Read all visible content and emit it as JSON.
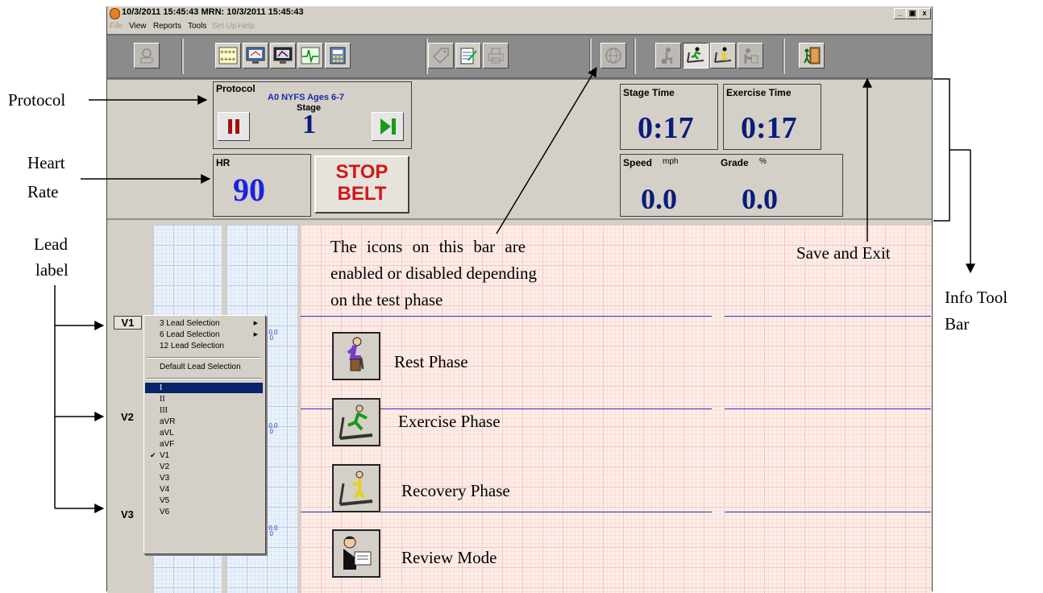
{
  "window": {
    "title": "10/3/2011 15:45:43   MRN: 10/3/2011 15:45:43",
    "controls": {
      "minimize": "_",
      "maximize": " ",
      "close": "x"
    }
  },
  "menu": [
    "File",
    "View",
    "Reports",
    "Tools",
    "Set Up",
    "Help"
  ],
  "menu_disabled": [
    "File",
    "Set Up",
    "Help"
  ],
  "protocol": {
    "label": "Protocol",
    "name": "A0 NYFS Ages 6-7",
    "stage_label": "Stage",
    "stage_value": "1"
  },
  "hr": {
    "label": "HR",
    "value": "90"
  },
  "stop_belt": {
    "line1": "STOP",
    "line2": "BELT"
  },
  "stage_time": {
    "label": "Stage Time",
    "value": "0:17"
  },
  "exercise_time": {
    "label": "Exercise Time",
    "value": "0:17"
  },
  "speed": {
    "label": "Speed",
    "unit": "mph",
    "value": "0.0"
  },
  "grade": {
    "label": "Grade",
    "unit": "%",
    "value": "0.0"
  },
  "leads": [
    "V1",
    "V2",
    "V3"
  ],
  "calibration": {
    "l": "L 0.0",
    "s": "S 0"
  },
  "context_menu": {
    "top_items": [
      {
        "label": "3 Lead Selection",
        "submenu": true
      },
      {
        "label": "6 Lead Selection",
        "submenu": true
      },
      {
        "label": "12 Lead Selection",
        "submenu": false
      }
    ],
    "default_item": "Default Lead Selection",
    "lead_items": [
      "I",
      "II",
      "III",
      "aVR",
      "aVL",
      "aVF",
      "V1",
      "V2",
      "V3",
      "V4",
      "V5",
      "V6"
    ],
    "selected_item": "I",
    "checked_item": "V1"
  },
  "annotations": {
    "protocol": "Protocol",
    "heart_rate_1": "Heart",
    "heart_rate_2": "Rate",
    "lead_label_1": "Lead",
    "lead_label_2": "label",
    "icons_note_1": "The icons on this bar are",
    "icons_note_2": "enabled or disabled depending",
    "icons_note_3": "on the test phase",
    "save_exit": "Save and Exit",
    "info_tool_bar_1": "Info Tool",
    "info_tool_bar_2": "Bar"
  },
  "phases": [
    {
      "label": "Rest Phase",
      "icon": "rest-phase-icon"
    },
    {
      "label": "Exercise Phase",
      "icon": "exercise-phase-icon"
    },
    {
      "label": "Recovery Phase",
      "icon": "recovery-phase-icon"
    },
    {
      "label": "Review Mode",
      "icon": "review-mode-icon"
    }
  ],
  "colors": {
    "value_blue": "#0a1c7a",
    "hr_blue": "#1a22e0",
    "stop_red": "#d01818",
    "pause_red": "#a01010",
    "next_green": "#1a9a1a"
  },
  "toolbar_icons": [
    "patient-icon",
    "grid-icon",
    "monitor-icon",
    "monitor-review-icon",
    "ecg-icon",
    "calculator-icon",
    "tag-icon",
    "notes-icon",
    "printer-icon",
    "globe-icon",
    "rest-icon",
    "exercise-icon",
    "recovery-icon",
    "review-icon",
    "save-exit-icon"
  ]
}
